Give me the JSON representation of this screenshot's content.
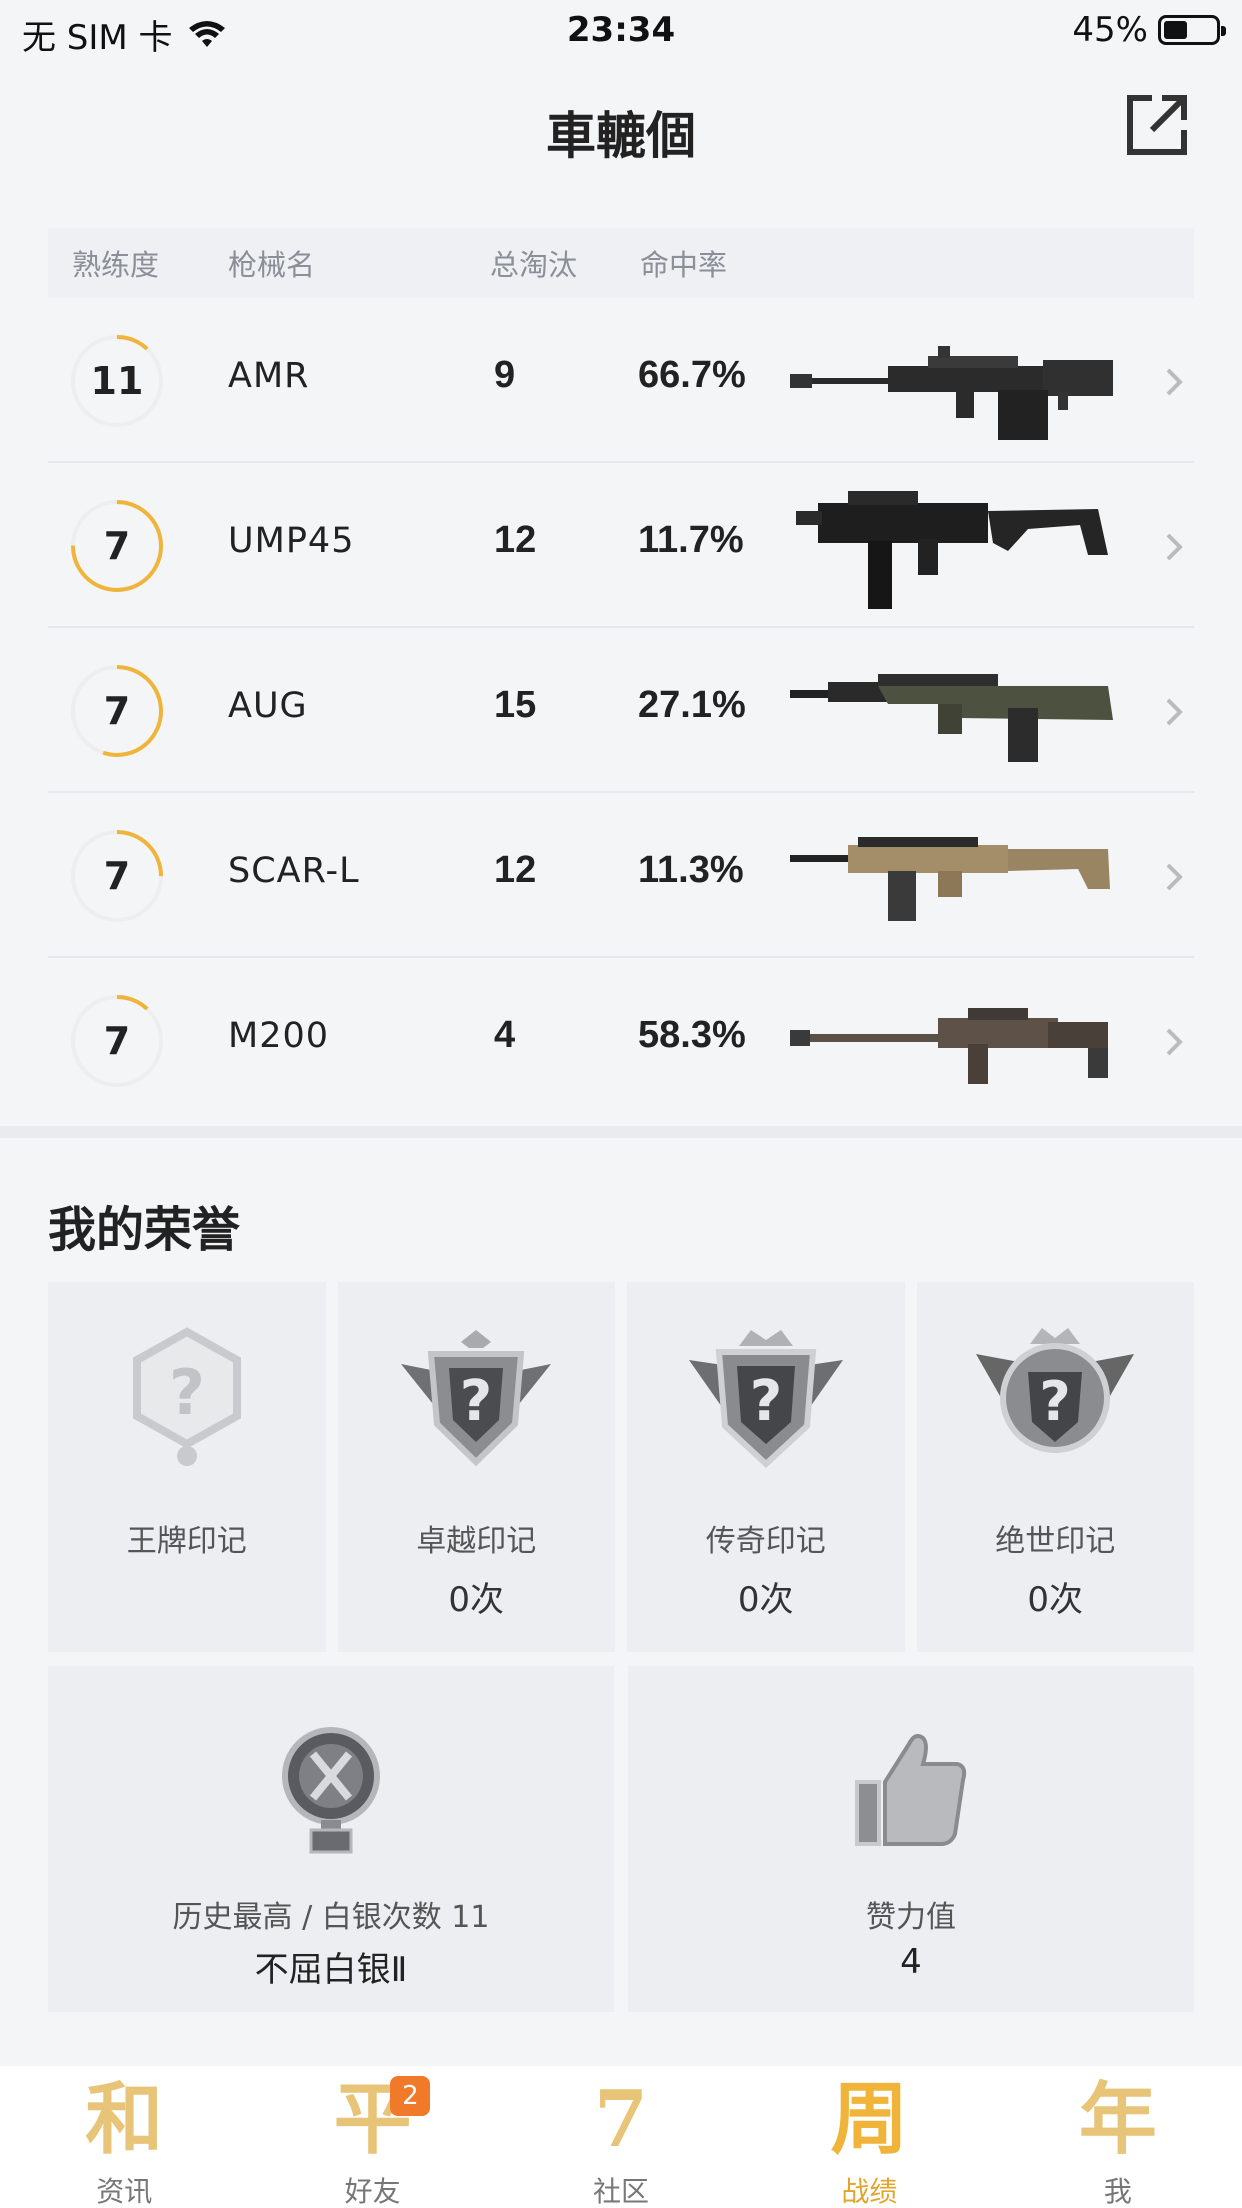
{
  "status_bar": {
    "carrier": "无 SIM 卡",
    "time": "23:34",
    "battery_percent": "45%",
    "battery_level": 0.45
  },
  "header": {
    "title": "車轆個"
  },
  "weapons": {
    "columns": [
      "熟练度",
      "枪械名",
      "总淘汰",
      "命中率"
    ],
    "rows": [
      {
        "proficiency": "11",
        "name": "AMR",
        "kills": "9",
        "accuracy": "66.7%",
        "progress": 0.12
      },
      {
        "proficiency": "7",
        "name": "UMP45",
        "kills": "12",
        "accuracy": "11.7%",
        "progress": 0.75
      },
      {
        "proficiency": "7",
        "name": "AUG",
        "kills": "15",
        "accuracy": "27.1%",
        "progress": 0.55
      },
      {
        "proficiency": "7",
        "name": "SCAR-L",
        "kills": "12",
        "accuracy": "11.3%",
        "progress": 0.25
      },
      {
        "proficiency": "7",
        "name": "M200",
        "kills": "4",
        "accuracy": "58.3%",
        "progress": 0.12
      }
    ]
  },
  "honors": {
    "title": "我的荣誉",
    "badges": [
      {
        "label": "王牌印记",
        "count": ""
      },
      {
        "label": "卓越印记",
        "count": "0次"
      },
      {
        "label": "传奇印记",
        "count": "0次"
      },
      {
        "label": "绝世印记",
        "count": "0次"
      }
    ],
    "stats": [
      {
        "label": "历史最高 / 白银次数 11",
        "value": "不屈白银Ⅱ"
      },
      {
        "label": "赞力值",
        "value": "4"
      }
    ]
  },
  "tabbar": {
    "tabs": [
      {
        "glyph": "和",
        "label": "资讯"
      },
      {
        "glyph": "平",
        "label": "好友",
        "badge": "2"
      },
      {
        "glyph": "7",
        "label": "社区"
      },
      {
        "glyph": "周",
        "label": "战绩",
        "active": true
      },
      {
        "glyph": "年",
        "label": "我"
      }
    ]
  },
  "colors": {
    "accent": "#f0b43a",
    "ring_track": "#eeeeee",
    "badge": "#f07a2a"
  }
}
